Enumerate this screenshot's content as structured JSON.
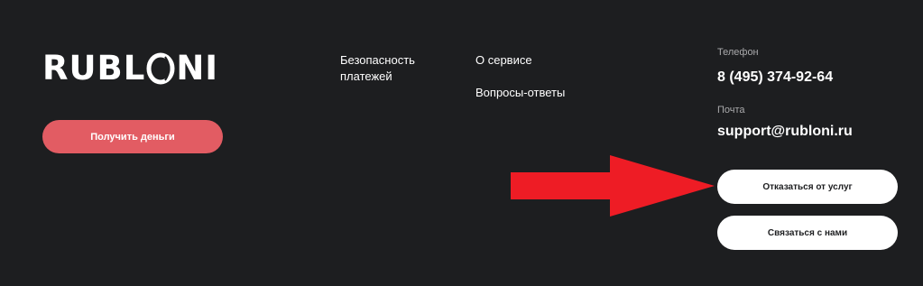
{
  "logo": {
    "part1": "RUBL",
    "part2": "NI"
  },
  "cta": {
    "get_money": "Получить деньги"
  },
  "nav": {
    "security_line1": "Безопасность",
    "security_line2": "платежей",
    "about": "О сервисе",
    "faq": "Вопросы-ответы"
  },
  "contacts": {
    "phone_label": "Телефон",
    "phone": "8 (495) 374-92-64",
    "mail_label": "Почта",
    "email": "support@rubloni.ru"
  },
  "actions": {
    "refuse_services": "Отказаться от услуг",
    "contact_us": "Связаться с нами"
  },
  "colors": {
    "background": "#1d1e20",
    "accent": "#e25c63",
    "arrow": "#ee1c25",
    "muted_text": "#a9a9ab"
  }
}
